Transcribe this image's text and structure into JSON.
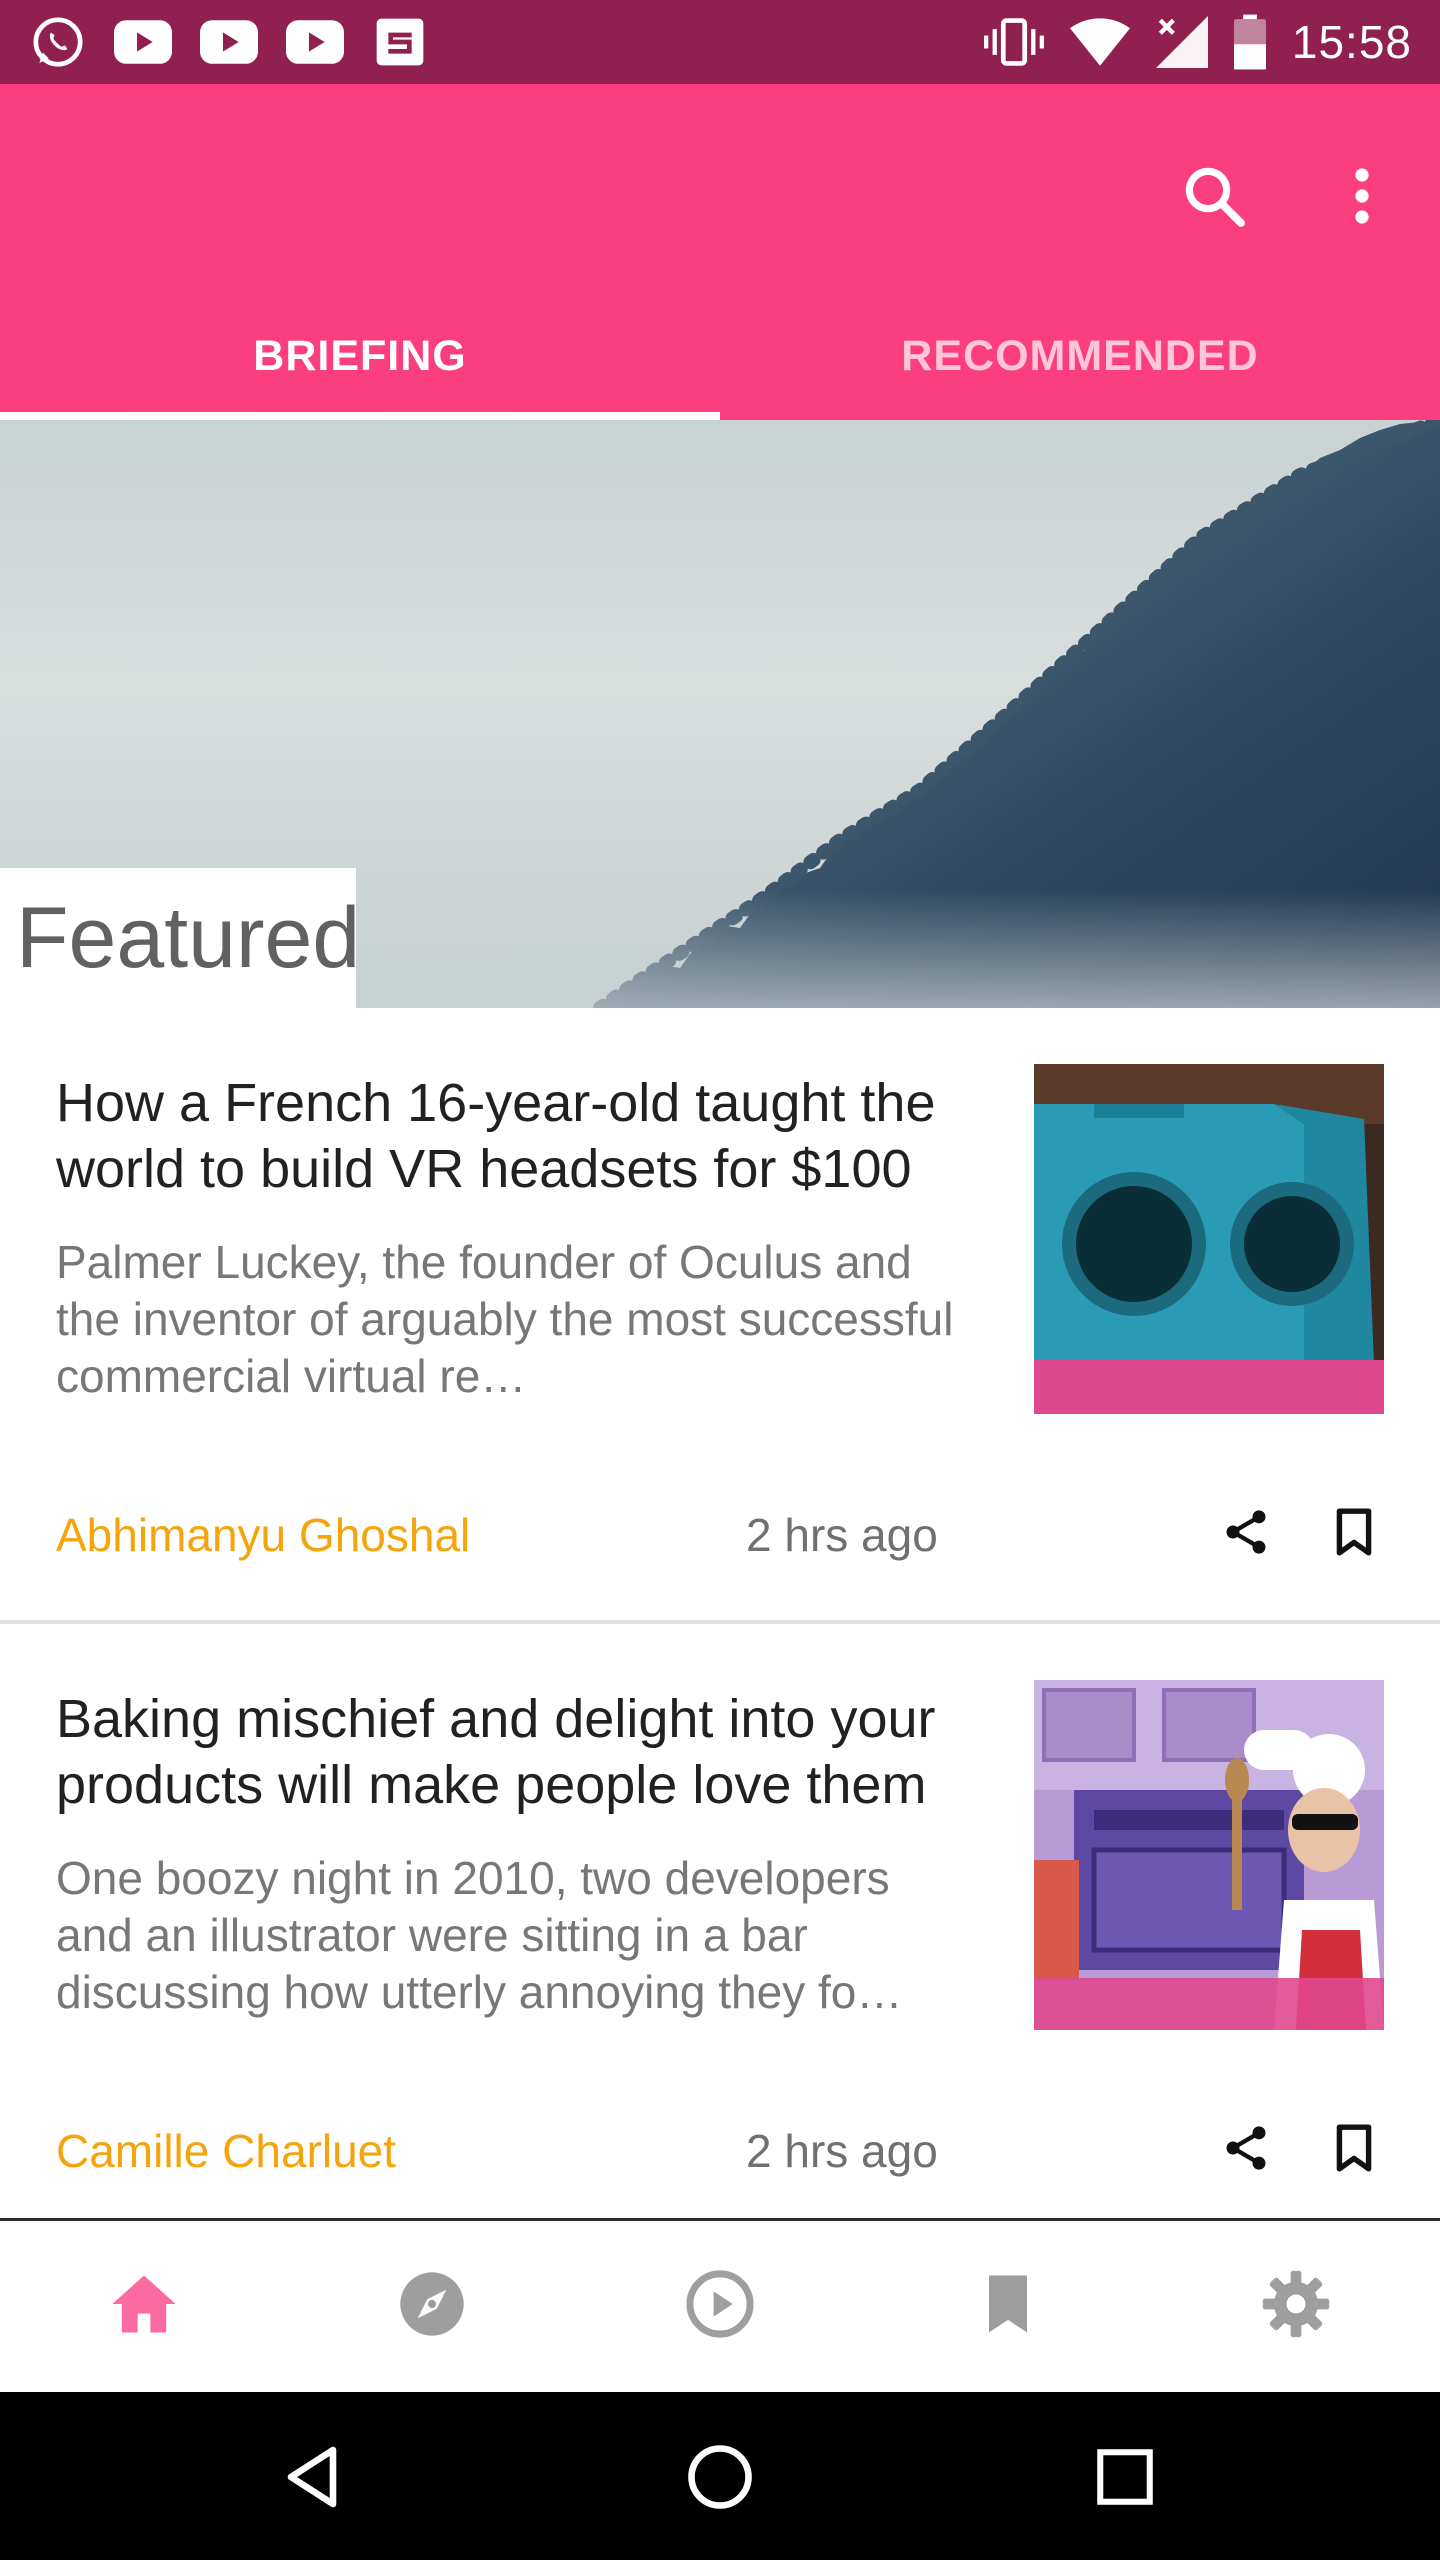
{
  "status_bar": {
    "time": "15:58",
    "left_icons": [
      "whatsapp-icon",
      "youtube-icon",
      "youtube-icon",
      "youtube-icon",
      "app-notification-icon"
    ],
    "right_icons": [
      "vibrate-icon",
      "wifi-icon",
      "signal-icon",
      "battery-icon"
    ]
  },
  "app_bar": {
    "actions": [
      "search-icon",
      "more-vert-icon"
    ],
    "tabs": [
      {
        "label": "BRIEFING",
        "selected": true
      },
      {
        "label": "RECOMMENDED",
        "selected": false
      }
    ]
  },
  "hero": {
    "section_label": "Featured"
  },
  "articles": [
    {
      "title": "How a French 16-year-old taught the world to build VR headsets for $100",
      "summary": "Palmer Luckey, the founder of Oculus and the inventor of arguably the most successful commercial virtual re…",
      "author": "Abhimanyu Ghoshal",
      "time": "2 hrs ago"
    },
    {
      "title": "Baking mischief and delight into your products will make people love them",
      "summary": "One boozy night in 2010, two developers and an illustrator were sitting in a bar discussing how utterly annoying they fo…",
      "author": "Camille Charluet",
      "time": "2 hrs ago"
    }
  ],
  "bottom_nav": {
    "items": [
      "home-icon",
      "explore-icon",
      "play-icon",
      "bookmarks-icon",
      "settings-icon"
    ],
    "active_color": "#fb6aa0",
    "inactive_color": "#9e9e9e"
  },
  "colors": {
    "status_bar": "#8f2050",
    "accent": "#fb3e7f",
    "author": "#f5a40c"
  }
}
